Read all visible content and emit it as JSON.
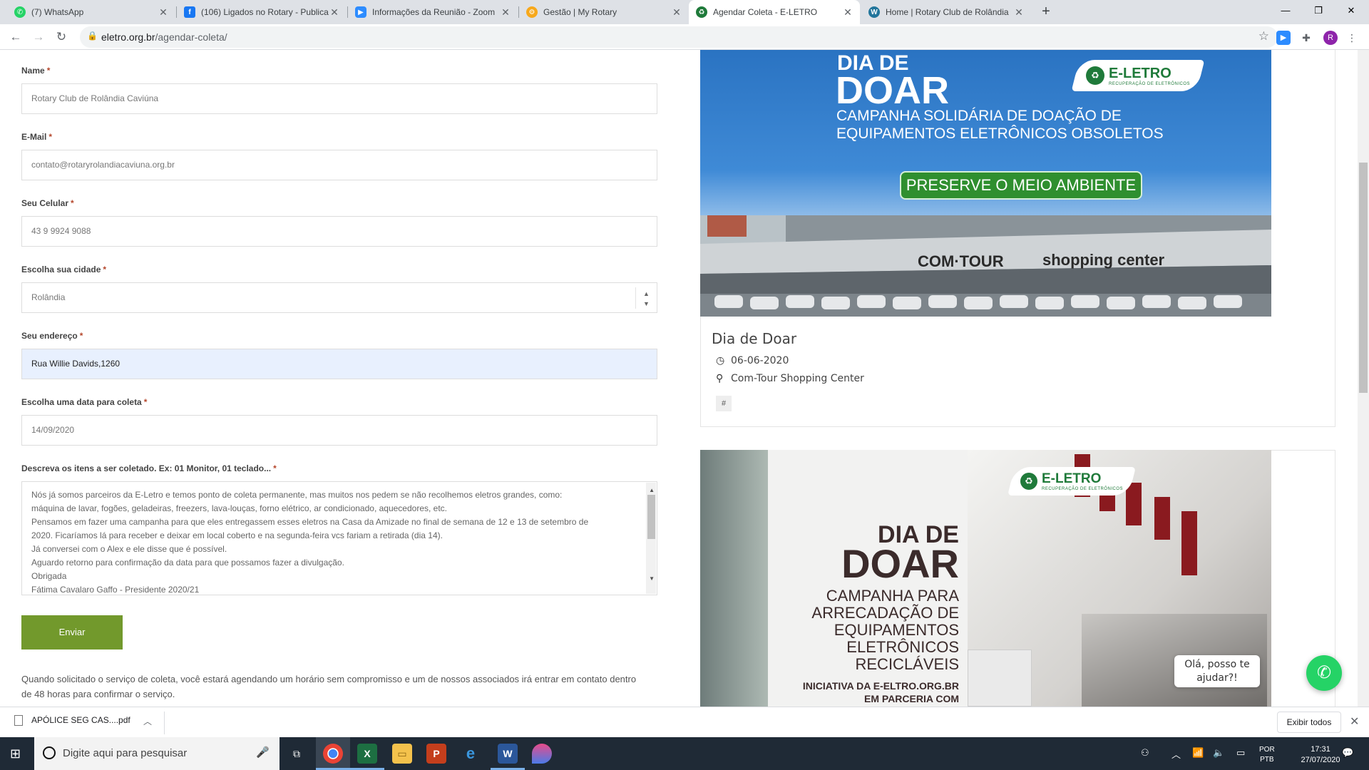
{
  "browser": {
    "tabs": [
      {
        "title": "(7) WhatsApp",
        "icon": "whatsapp-icon",
        "color": "#25d366"
      },
      {
        "title": "(106) Ligados no Rotary - Publica",
        "icon": "facebook-icon",
        "color": "#1877f2"
      },
      {
        "title": "Informações da Reunião - Zoom",
        "icon": "zoom-icon",
        "color": "#2d8cff"
      },
      {
        "title": "Gestão | My Rotary",
        "icon": "rotary-icon",
        "color": "#f7a81b"
      },
      {
        "title": "Agendar Coleta - E-LETRO",
        "icon": "eletro-icon",
        "color": "#1f7a3a"
      },
      {
        "title": "Home | Rotary Club de Rolândia",
        "icon": "wordpress-icon",
        "color": "#21759b"
      }
    ],
    "url_host": "eletro.org.br",
    "url_path": "/agendar-coleta/",
    "profile_initial": "R"
  },
  "form": {
    "name_label": "Name",
    "name_value": "Rotary Club de Rolândia Caviúna",
    "email_label": "E-Mail",
    "email_value": "contato@rotaryrolandiacaviuna.org.br",
    "phone_label": "Seu Celular",
    "phone_value": "43 9 9924 9088",
    "city_label": "Escolha sua cidade",
    "city_value": "Rolândia",
    "address_label": "Seu endereço",
    "address_value": "Rua Willie Davids,1260",
    "date_label": "Escolha uma data para coleta",
    "date_value": "14/09/2020",
    "items_label": "Descreva os itens a ser coletado. Ex: 01 Monitor, 01 teclado...",
    "required_mark": "*",
    "items_lines": [
      "Nós já somos parceiros da E-Letro e temos ponto de coleta permanente, mas muitos nos pedem se não recolhemos eletros grandes, como:",
      "máquina de lavar, fogões, geladeiras, freezers, lava-louças, forno elétrico, ar condicionado, aquecedores, etc.",
      "Pensamos em fazer uma campanha para que eles entregassem esses eletros na Casa da Amizade no final de semana de 12 e 13 de setembro de",
      "2020. Ficaríamos lá para receber e deixar em local coberto e na segunda-feira vcs fariam a retirada (dia 14).",
      "Já conversei com o Alex e ele disse que é possível.",
      "Aguardo retorno para confirmação da data para que possamos fazer a divulgação.",
      "Obrigada",
      "Fátima Cavalaro Gaffo - Presidente 2020/21"
    ],
    "submit_label": "Enviar",
    "note": "Quando solicitado o serviço de coleta, você estará agendando um horário sem compromisso e um de nossos associados irá entrar em contato dentro de 48 horas para confirmar o serviço."
  },
  "events": [
    {
      "banner": {
        "logo": "E-LETRO",
        "logo_sub": "RECUPERAÇÃO DE ELETRÔNICOS",
        "line1": "DIA DE",
        "line2": "DOAR",
        "line3": "CAMPANHA SOLIDÁRIA DE DOAÇÃO DE",
        "line4": "EQUIPAMENTOS ELETRÔNICOS OBSOLETOS",
        "badge": "PRESERVE O MEIO AMBIENTE",
        "sign1": "COM·TOUR",
        "sign2": "shopping center"
      },
      "title": "Dia de Doar",
      "date": "06-06-2020",
      "location": "Com-Tour Shopping Center",
      "tag": "#"
    },
    {
      "banner": {
        "logo": "E-LETRO",
        "logo_sub": "RECUPERAÇÃO DE ELETRÔNICOS",
        "line1": "DIA DE",
        "line2": "DOAR",
        "line3": "CAMPANHA PARA",
        "line4": "ARRECADAÇÃO DE",
        "line5": "EQUIPAMENTOS",
        "line6": "ELETRÔNICOS",
        "line7": "RECICLÁVEIS",
        "line8": "INICIATIVA DA E-ELTRO.ORG.BR",
        "line9": "EM PARCERIA COM"
      }
    }
  ],
  "chat": {
    "bubble_line1": "Olá, posso te",
    "bubble_line2": "ajudar?!"
  },
  "download": {
    "filename": "APÓLICE SEG CAS....pdf",
    "show_all": "Exibir todos"
  },
  "taskbar": {
    "search_placeholder": "Digite aqui para pesquisar",
    "lang1": "POR",
    "lang2": "PTB",
    "time": "17:31",
    "date": "27/07/2020"
  }
}
